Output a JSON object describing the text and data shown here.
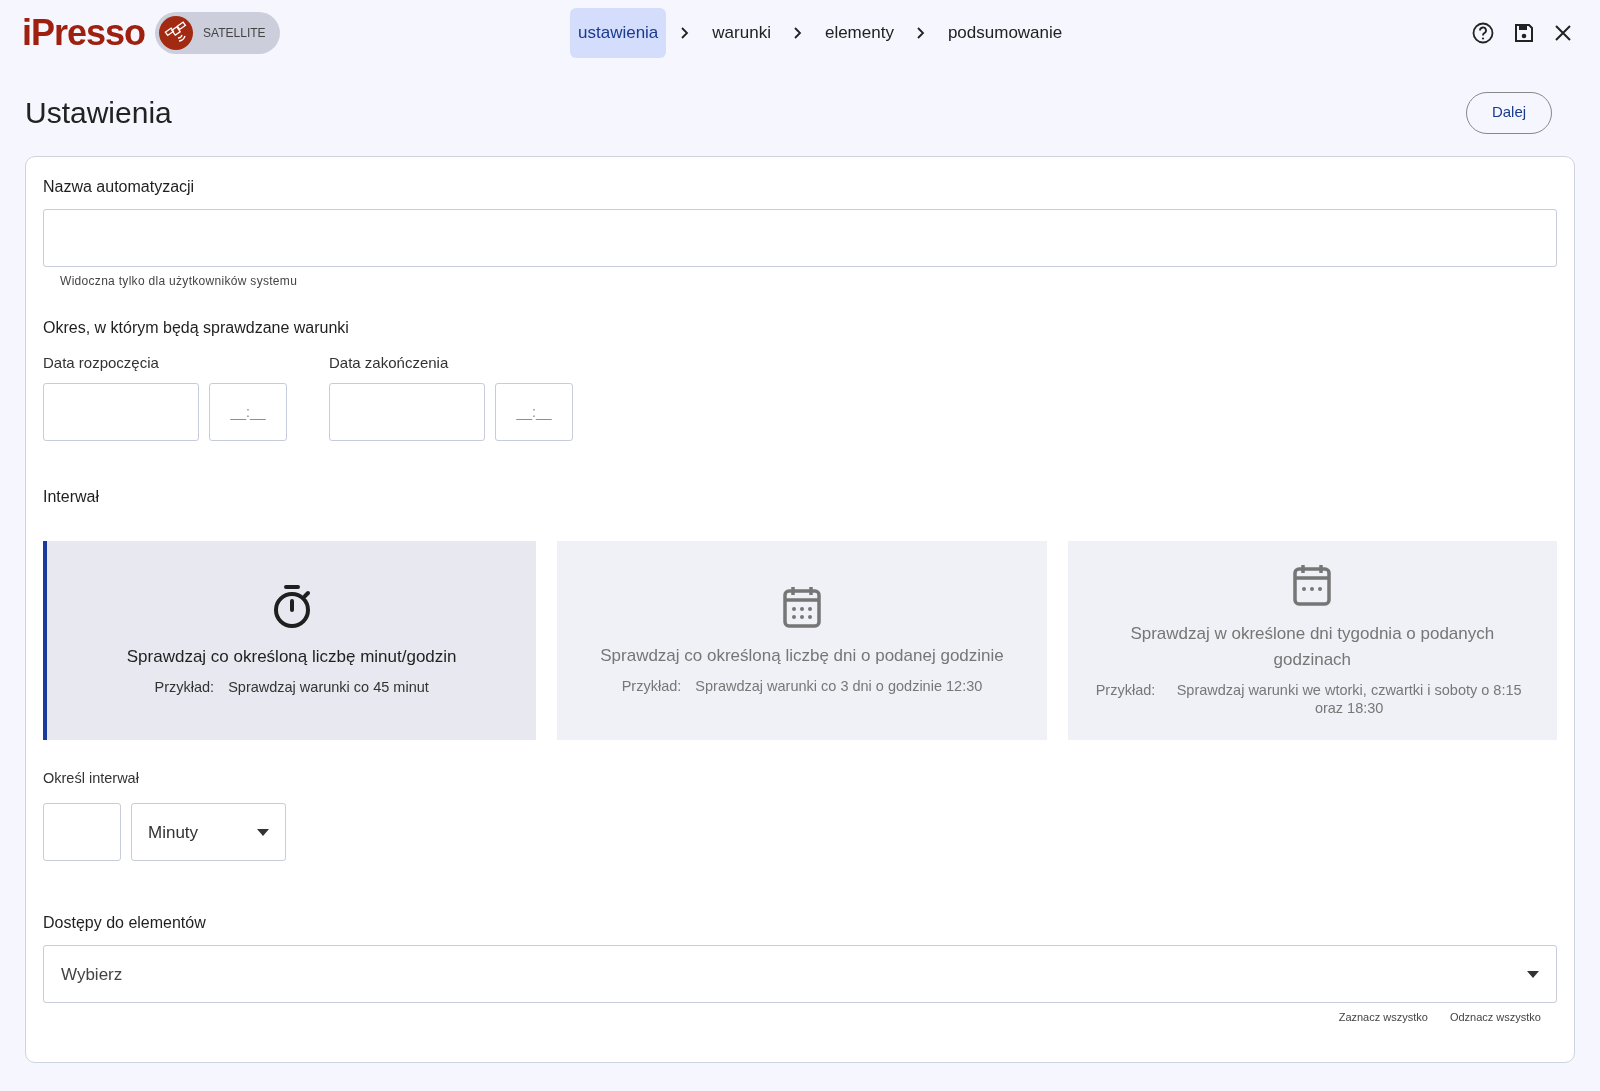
{
  "header": {
    "logo": "iPresso",
    "badge": "SATELLITE",
    "steps": [
      {
        "label": "ustawienia",
        "selected": true
      },
      {
        "label": "warunki",
        "selected": false
      },
      {
        "label": "elementy",
        "selected": false
      },
      {
        "label": "podsumowanie",
        "selected": false
      }
    ]
  },
  "page": {
    "title": "Ustawienia",
    "next_button": "Dalej"
  },
  "form": {
    "name": {
      "label": "Nazwa automatyzacji",
      "hint": "Widoczna tylko dla użytkowników systemu"
    },
    "period": {
      "heading": "Okres, w którym będą sprawdzane warunki",
      "fields": [
        {
          "label": "Data rozpoczęcia",
          "time_placeholder": "__:__"
        },
        {
          "label": "Data zakończenia",
          "time_placeholder": "__:__"
        }
      ]
    },
    "interval": {
      "heading": "Interwał",
      "options": [
        {
          "kind": "minutes",
          "title": "Sprawdzaj co określoną liczbę minut/godzin",
          "example_label": "Przykład:",
          "example": "Sprawdzaj warunki co 45 minut",
          "selected": true
        },
        {
          "kind": "days",
          "title": "Sprawdzaj co określoną liczbę dni o podanej godzinie",
          "example_label": "Przykład:",
          "example": "Sprawdzaj warunki co 3 dni o godzinie 12:30",
          "selected": false
        },
        {
          "kind": "weekdays",
          "title": "Sprawdzaj w określone dni tygodnia o podanych godzinach",
          "example_label": "Przykład:",
          "example": "Sprawdzaj warunki we wtorki, czwartki i soboty o 8:15 oraz 18:30",
          "selected": false
        }
      ],
      "define_label": "Określ interwał",
      "unit": "Minuty"
    },
    "access": {
      "label": "Dostępy do elementów",
      "value": "Wybierz",
      "select_all": "Zaznacz wszystko",
      "deselect_all": "Odznacz wszystko"
    }
  }
}
